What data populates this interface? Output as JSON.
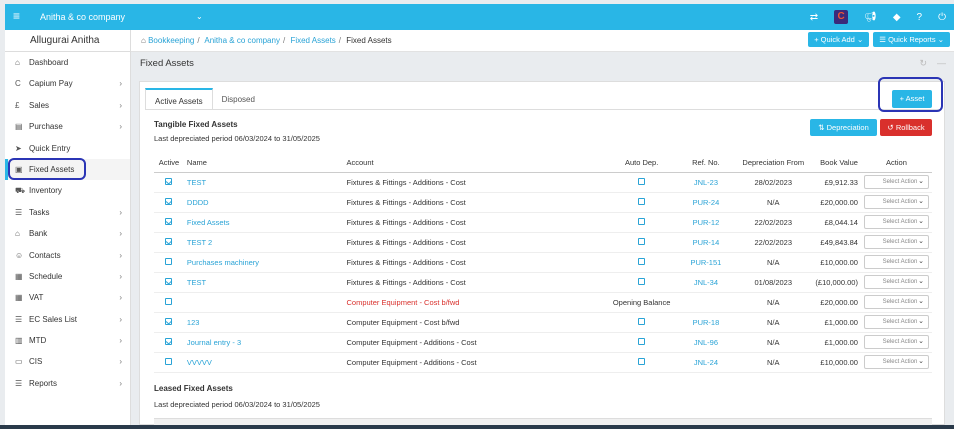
{
  "topbar": {
    "company": "Anitha & co company",
    "icons": [
      "menu-icon",
      "transfer-icon",
      "capium-logo-icon",
      "megaphone-icon",
      "ticket-icon",
      "help-icon",
      "power-icon"
    ],
    "capium_letter": "C"
  },
  "sidebar": {
    "user": "Allugurai Anitha",
    "items": [
      {
        "label": "Dashboard",
        "icon": "home-icon",
        "chevron": false
      },
      {
        "label": "Capium Pay",
        "icon": "capium-pay-icon",
        "chevron": true
      },
      {
        "label": "Sales",
        "icon": "pound-icon",
        "chevron": true
      },
      {
        "label": "Purchase",
        "icon": "purchase-icon",
        "chevron": true
      },
      {
        "label": "Quick Entry",
        "icon": "quick-entry-icon",
        "chevron": false
      },
      {
        "label": "Fixed Assets",
        "icon": "fixed-assets-icon",
        "chevron": false,
        "active": true
      },
      {
        "label": "Inventory",
        "icon": "truck-icon",
        "chevron": false
      },
      {
        "label": "Tasks",
        "icon": "tasks-icon",
        "chevron": true
      },
      {
        "label": "Bank",
        "icon": "bank-icon",
        "chevron": true
      },
      {
        "label": "Contacts",
        "icon": "contacts-icon",
        "chevron": true
      },
      {
        "label": "Schedule",
        "icon": "calendar-icon",
        "chevron": true
      },
      {
        "label": "VAT",
        "icon": "vat-icon",
        "chevron": true
      },
      {
        "label": "EC Sales List",
        "icon": "ec-sales-icon",
        "chevron": true
      },
      {
        "label": "MTD",
        "icon": "mtd-icon",
        "chevron": true
      },
      {
        "label": "CIS",
        "icon": "cis-icon",
        "chevron": true
      },
      {
        "label": "Reports",
        "icon": "reports-icon",
        "chevron": true
      }
    ]
  },
  "breadcrumb": {
    "items": [
      "Bookkeeping",
      "Anitha & co company",
      "Fixed Assets",
      "Fixed Assets"
    ],
    "quick_add": "+ Quick Add",
    "quick_reports": "Quick Reports"
  },
  "page": {
    "title": "Fixed Assets"
  },
  "tabs": [
    "Active Assets",
    "Disposed"
  ],
  "buttons": {
    "asset": "+ Asset",
    "depreciation": "Depreciation",
    "rollback": "Rollback"
  },
  "tangible": {
    "title": "Tangible Fixed Assets",
    "period": "Last depreciated period 06/03/2024 to 31/05/2025"
  },
  "leased": {
    "title": "Leased Fixed Assets",
    "period": "Last depreciated period 06/03/2024 to 31/05/2025"
  },
  "table": {
    "headers": [
      "Active",
      "Name",
      "Account",
      "Auto Dep.",
      "Ref. No.",
      "Depreciation From",
      "Book Value",
      "Action"
    ],
    "select_placeholder": "Select Action",
    "rows": [
      {
        "active": true,
        "name": "TEST",
        "account": "Fixtures & Fittings - Additions - Cost",
        "account_red": false,
        "auto_dep": "",
        "ref": "JNL-23",
        "dep_from": "28/02/2023",
        "book_value": "£9,912.33"
      },
      {
        "active": true,
        "name": "DDDD",
        "account": "Fixtures & Fittings - Additions - Cost",
        "account_red": false,
        "auto_dep": "",
        "ref": "PUR-24",
        "dep_from": "N/A",
        "book_value": "£20,000.00"
      },
      {
        "active": true,
        "name": "Fixed Assets",
        "account": "Fixtures & Fittings - Additions - Cost",
        "account_red": false,
        "auto_dep": "",
        "ref": "PUR-12",
        "dep_from": "22/02/2023",
        "book_value": "£8,044.14"
      },
      {
        "active": true,
        "name": "TEST 2",
        "account": "Fixtures & Fittings - Additions - Cost",
        "account_red": false,
        "auto_dep": "",
        "ref": "PUR-14",
        "dep_from": "22/02/2023",
        "book_value": "£49,843.84"
      },
      {
        "active": false,
        "name": "Purchases machinery",
        "account": "Fixtures & Fittings - Additions - Cost",
        "account_red": false,
        "auto_dep": "",
        "ref": "PUR-151",
        "dep_from": "N/A",
        "book_value": "£10,000.00"
      },
      {
        "active": true,
        "name": "TEST",
        "account": "Fixtures & Fittings - Additions - Cost",
        "account_red": false,
        "auto_dep": "",
        "ref": "JNL-34",
        "dep_from": "01/08/2023",
        "book_value": "(£10,000.00)"
      },
      {
        "active": false,
        "name": "",
        "account": "Computer Equipment - Cost b/fwd",
        "account_red": true,
        "auto_dep": "Opening Balance",
        "ref": "",
        "dep_from": "N/A",
        "book_value": "£20,000.00"
      },
      {
        "active": true,
        "name": "123",
        "account": "Computer Equipment - Cost b/fwd",
        "account_red": false,
        "auto_dep": "",
        "ref": "PUR-18",
        "dep_from": "N/A",
        "book_value": "£1,000.00"
      },
      {
        "active": true,
        "name": "Journal entry - 3",
        "account": "Computer Equipment - Additions - Cost",
        "account_red": false,
        "auto_dep": "",
        "ref": "JNL-96",
        "dep_from": "N/A",
        "book_value": "£1,000.00"
      },
      {
        "active": false,
        "name": "VVVVV",
        "account": "Computer Equipment - Additions - Cost",
        "account_red": false,
        "auto_dep": "",
        "ref": "JNL-24",
        "dep_from": "N/A",
        "book_value": "£10,000.00"
      }
    ]
  }
}
